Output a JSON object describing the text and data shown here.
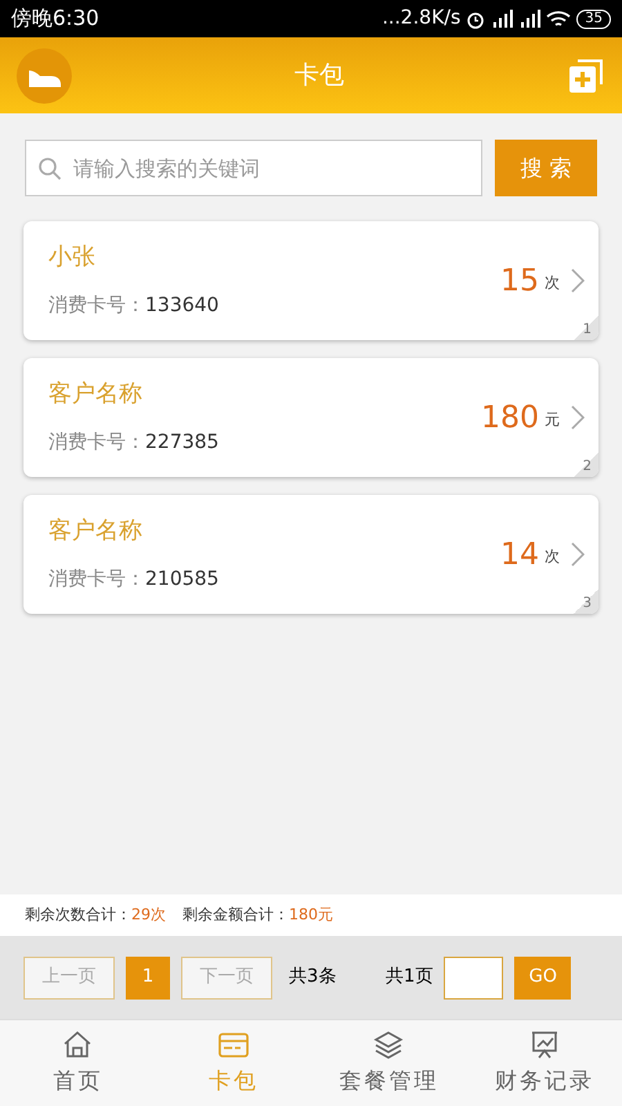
{
  "status_bar": {
    "time": "傍晚6:30",
    "speed": "...2.8K/s",
    "battery": "35"
  },
  "header": {
    "title": "卡包"
  },
  "search": {
    "placeholder": "请输入搜索的关键词",
    "button": "搜 索"
  },
  "cards": [
    {
      "name": "小张",
      "card_label": "消费卡号：",
      "card_no": "133640",
      "amount": "15",
      "unit": "次",
      "index": "1"
    },
    {
      "name": "客户名称",
      "card_label": "消费卡号：",
      "card_no": "227385",
      "amount": "180",
      "unit": "元",
      "index": "2"
    },
    {
      "name": "客户名称",
      "card_label": "消费卡号：",
      "card_no": "210585",
      "amount": "14",
      "unit": "次",
      "index": "3"
    }
  ],
  "summary": [
    {
      "label": "剩余次数合计：",
      "value": "29次"
    },
    {
      "label": "剩余金额合计：",
      "value": "180元"
    }
  ],
  "pagination": {
    "prev": "上一页",
    "pages": [
      {
        "label": "1",
        "selected": true
      }
    ],
    "next": "下一页",
    "total_items": "共3条",
    "total_pages": "共1页",
    "go": "GO"
  },
  "tabs": [
    {
      "label": "首页",
      "kind": "home",
      "selected": false
    },
    {
      "label": "卡包",
      "kind": "card",
      "selected": true
    },
    {
      "label": "套餐管理",
      "kind": "layers",
      "selected": false
    },
    {
      "label": "财务记录",
      "kind": "chart",
      "selected": false
    }
  ]
}
